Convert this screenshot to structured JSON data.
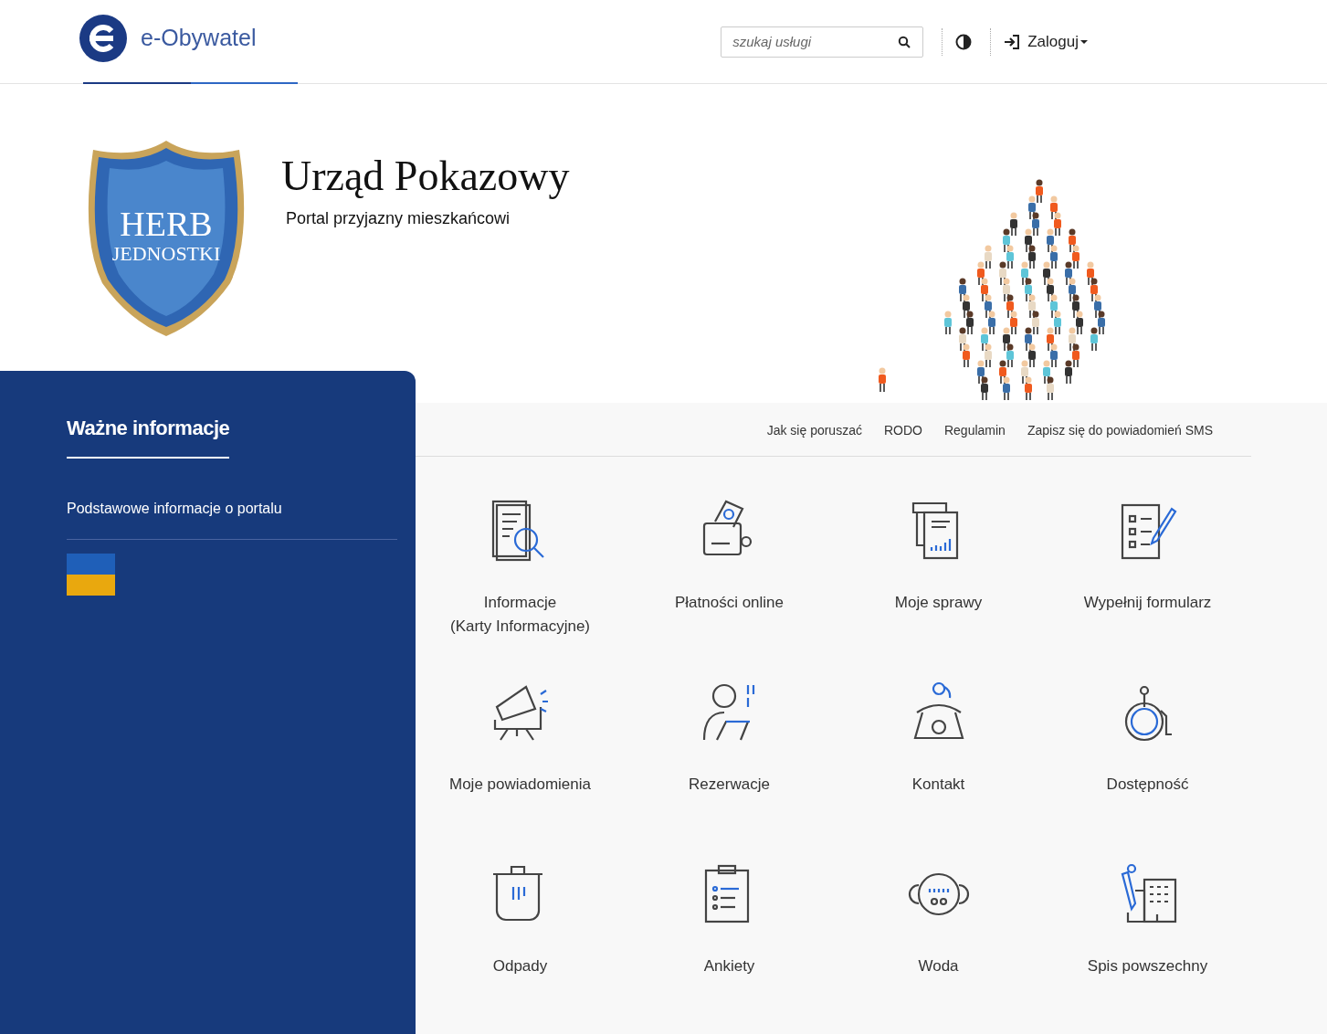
{
  "header": {
    "logo_text": "e-Obywatel",
    "search": {
      "placeholder": "szukaj usługi"
    },
    "login": "Zaloguj"
  },
  "hero": {
    "crest": [
      "HERB",
      "JEDNOSTKI"
    ],
    "title": "Urząd Pokazowy",
    "subtitle": "Portal przyjazny mieszkańcowi"
  },
  "sidebar": {
    "heading": "Ważne informacje",
    "links": [
      "Podstawowe informacje o portalu"
    ]
  },
  "top_links": [
    "Jak się poruszać",
    "RODO",
    "Regulamin",
    "Zapisz się do powiadomień SMS"
  ],
  "tiles": [
    {
      "lines": [
        "Informacje",
        "(Karty Informacyjne)"
      ]
    },
    {
      "lines": [
        "Płatności online"
      ]
    },
    {
      "lines": [
        "Moje sprawy"
      ]
    },
    {
      "lines": [
        "Wypełnij formularz"
      ]
    },
    {
      "lines": [
        "Moje powiadomienia"
      ]
    },
    {
      "lines": [
        "Rezerwacje"
      ]
    },
    {
      "lines": [
        "Kontakt"
      ]
    },
    {
      "lines": [
        "Dostępność"
      ]
    },
    {
      "lines": [
        "Odpady"
      ]
    },
    {
      "lines": [
        "Ankiety"
      ]
    },
    {
      "lines": [
        "Woda"
      ]
    },
    {
      "lines": [
        "Spis powszechny"
      ]
    }
  ]
}
